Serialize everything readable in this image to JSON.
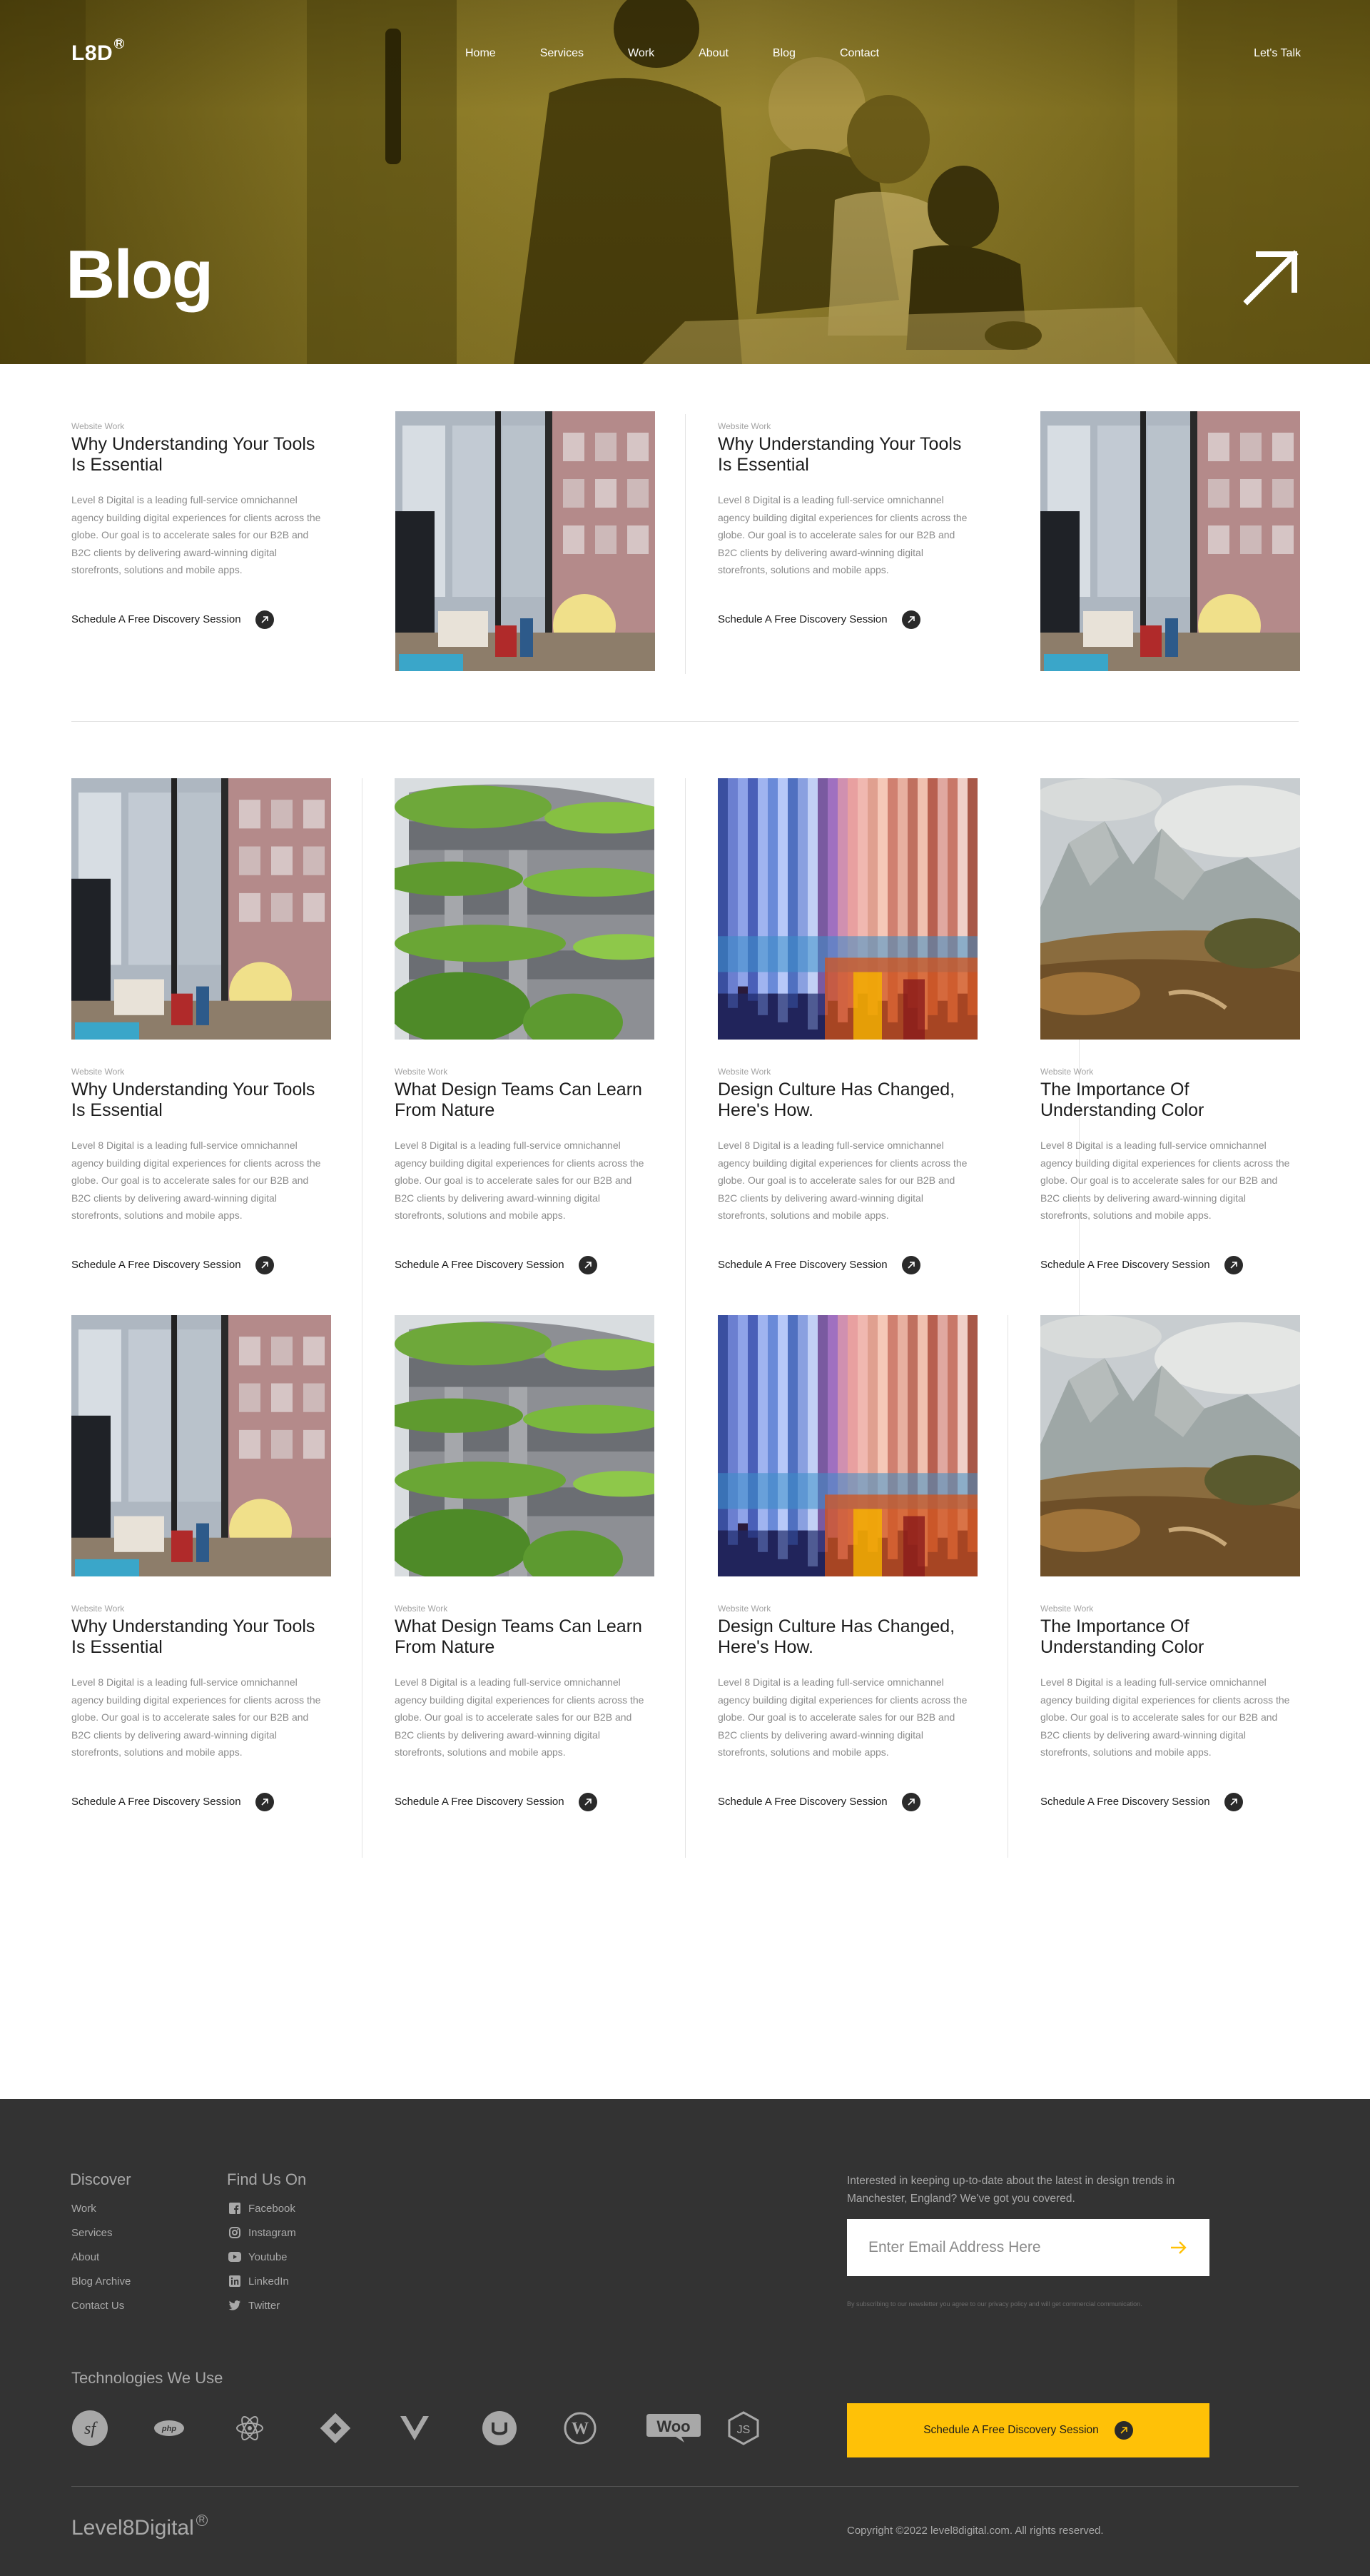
{
  "header": {
    "logo": "L8D",
    "logo_mark": "R",
    "nav": [
      "Home",
      "Services",
      "Work",
      "About",
      "Blog",
      "Contact"
    ],
    "cta": "Let's Talk",
    "title": "Blog"
  },
  "featured": [
    {
      "category": "Website Work",
      "title": "Why Understanding Your Tools Is Essential",
      "description": "Level 8 Digital is a leading full-service omnichannel agency building digital experiences for clients across the globe. Our goal is to accelerate sales for our B2B and B2C clients by delivering award-winning digital storefronts, solutions and mobile apps.",
      "cta": "Schedule A Free Discovery Session",
      "image": "office-window"
    },
    {
      "category": "Website Work",
      "title": "Why Understanding Your Tools Is Essential",
      "description": "Level 8 Digital is a leading full-service omnichannel agency building digital experiences for clients across the globe. Our goal is to accelerate sales for our B2B and B2C clients by delivering award-winning digital storefronts, solutions and mobile apps.",
      "cta": "Schedule A Free Discovery Session",
      "image": "office-window"
    }
  ],
  "posts_row1": [
    {
      "category": "Website Work",
      "title": "Why Understanding Your Tools Is Essential",
      "description": "Level 8 Digital is a leading full-service omnichannel agency building digital experiences for clients across the globe. Our goal is to accelerate sales for our B2B and B2C clients by delivering award-winning digital storefronts, solutions and mobile apps.",
      "cta": "Schedule A Free Discovery Session",
      "image": "office-window"
    },
    {
      "category": "Website Work",
      "title": "What Design Teams Can Learn From Nature",
      "description": "Level 8 Digital is a leading full-service omnichannel agency building digital experiences for clients across the globe. Our goal is to accelerate sales for our B2B and B2C clients by delivering award-winning digital storefronts, solutions and mobile apps.",
      "cta": "Schedule A Free Discovery Session",
      "image": "green-building"
    },
    {
      "category": "Website Work",
      "title": "Design Culture Has Changed, Here's How.",
      "description": "Level 8 Digital is a leading full-service omnichannel agency building digital experiences for clients across the globe. Our goal is to accelerate sales for our B2B and B2C clients by delivering award-winning digital storefronts, solutions and mobile apps.",
      "cta": "Schedule A Free Discovery Session",
      "image": "color-stripes"
    },
    {
      "category": "Website Work",
      "title": "The Importance Of Understanding Color",
      "description": "Level 8 Digital is a leading full-service omnichannel agency building digital experiences for clients across the globe. Our goal is to accelerate sales for our B2B and B2C clients by delivering award-winning digital storefronts, solutions and mobile apps.",
      "cta": "Schedule A Free Discovery Session",
      "image": "mountain-painting"
    }
  ],
  "posts_row2": [
    {
      "category": "Website Work",
      "title": "Why Understanding Your Tools Is Essential",
      "description": "Level 8 Digital is a leading full-service omnichannel agency building digital experiences for clients across the globe. Our goal is to accelerate sales for our B2B and B2C clients by delivering award-winning digital storefronts, solutions and mobile apps.",
      "cta": "Schedule A Free Discovery Session",
      "image": "office-window"
    },
    {
      "category": "Website Work",
      "title": "What Design Teams Can Learn From Nature",
      "description": "Level 8 Digital is a leading full-service omnichannel agency building digital experiences for clients across the globe. Our goal is to accelerate sales for our B2B and B2C clients by delivering award-winning digital storefronts, solutions and mobile apps.",
      "cta": "Schedule A Free Discovery Session",
      "image": "green-building"
    },
    {
      "category": "Website Work",
      "title": "Design Culture Has Changed, Here's How.",
      "description": "Level 8 Digital is a leading full-service omnichannel agency building digital experiences for clients across the globe. Our goal is to accelerate sales for our B2B and B2C clients by delivering award-winning digital storefronts, solutions and mobile apps.",
      "cta": "Schedule A Free Discovery Session",
      "image": "color-stripes"
    },
    {
      "category": "Website Work",
      "title": "The Importance Of Understanding Color",
      "description": "Level 8 Digital is a leading full-service omnichannel agency building digital experiences for clients across the globe. Our goal is to accelerate sales for our B2B and B2C clients by delivering award-winning digital storefronts, solutions and mobile apps.",
      "cta": "Schedule A Free Discovery Session",
      "image": "mountain-painting"
    }
  ],
  "footer": {
    "discover_title": "Discover",
    "discover_links": [
      "Work",
      "Services",
      "About",
      "Blog Archive",
      "Contact Us"
    ],
    "find_title": "Find Us On",
    "social": [
      {
        "label": "Facebook",
        "icon": "facebook-icon"
      },
      {
        "label": "Instagram",
        "icon": "instagram-icon"
      },
      {
        "label": "Youtube",
        "icon": "youtube-icon"
      },
      {
        "label": "LinkedIn",
        "icon": "linkedin-icon"
      },
      {
        "label": "Twitter",
        "icon": "twitter-icon"
      }
    ],
    "newsletter_text": "Interested in keeping up-to-date about the latest in design trends in Manchester, England? We've got you covered.",
    "email_placeholder": "Enter Email Address Here",
    "fine_print": "By subscribing to our newsletter you agree to our privacy policy and will get commercial communication.",
    "tech_title": "Technologies We Use",
    "tech_icons": [
      "symfony-icon",
      "php-icon",
      "react-icon",
      "craft-icon",
      "vue-icon",
      "umbraco-icon",
      "wordpress-icon",
      "woocommerce-icon",
      "nodejs-icon"
    ],
    "cta": "Schedule A Free Discovery Session",
    "brand": "Level8Digital",
    "brand_mark": "R",
    "copyright": "Copyright ©2022 level8digital.com. All rights reserved."
  },
  "colors": {
    "accent": "#ffc107",
    "hero_tint": "#7a6a1c",
    "footer_bg": "#333333"
  }
}
